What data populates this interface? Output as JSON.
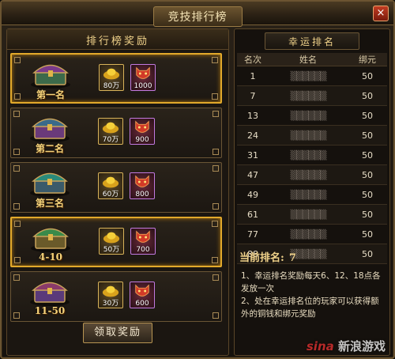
{
  "window": {
    "title": "竞技排行榜",
    "close_glyph": "×"
  },
  "left_panel": {
    "header": "排行榜奖励",
    "rewards": [
      {
        "rank": "第一名",
        "gold": "80万",
        "mask": "1000"
      },
      {
        "rank": "第二名",
        "gold": "70万",
        "mask": "900"
      },
      {
        "rank": "第三名",
        "gold": "60万",
        "mask": "800"
      },
      {
        "rank": "4-10",
        "gold": "50万",
        "mask": "700"
      },
      {
        "rank": "11-50",
        "gold": "30万",
        "mask": "600"
      }
    ],
    "claim_button": "领取奖励"
  },
  "right_panel": {
    "header": "幸运排名",
    "columns": [
      "名次",
      "姓名",
      "绑元"
    ],
    "rows": [
      {
        "rank": "1",
        "name": "▒▒▒▒▒▒",
        "bind": "50"
      },
      {
        "rank": "7",
        "name": "▒▒▒▒▒▒",
        "bind": "50"
      },
      {
        "rank": "13",
        "name": "▒▒▒▒▒▒",
        "bind": "50"
      },
      {
        "rank": "24",
        "name": "▒▒▒▒▒▒",
        "bind": "50"
      },
      {
        "rank": "31",
        "name": "▒▒▒▒▒▒",
        "bind": "50"
      },
      {
        "rank": "47",
        "name": "▒▒▒▒▒▒",
        "bind": "50"
      },
      {
        "rank": "49",
        "name": "▒▒▒▒▒▒",
        "bind": "50"
      },
      {
        "rank": "61",
        "name": "▒▒▒▒▒▒",
        "bind": "50"
      },
      {
        "rank": "77",
        "name": "▒▒▒▒▒▒",
        "bind": "50"
      },
      {
        "rank": "88",
        "name": "▒▒▒▒▒▒",
        "bind": "50"
      }
    ],
    "my_rank_label": "当前排名:",
    "my_rank_value": "7",
    "notes": [
      "1、幸运排名奖励每天6、12、18点各发放一次",
      "2、处在幸运排名位的玩家可以获得额外的铜钱和绑元奖励"
    ]
  },
  "watermark": {
    "brand": "sina",
    "text": "新浪游戏"
  },
  "colors": {
    "accent_gold": "#e2a92b",
    "frame_brown": "#6b5431",
    "close_red": "#c23d22"
  }
}
